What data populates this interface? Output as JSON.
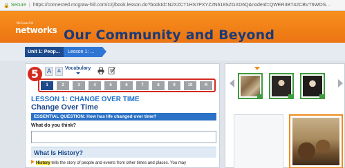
{
  "browser": {
    "secure_label": "Secure",
    "url": "https://connected.mcgraw-hill.com/c2j/book.lesson.do?bookId=N2XZCT1HS7PXYZ2N618SZGXD6Q&nodeId=QWER3BT42CBVT6WOS..."
  },
  "banner": {
    "publisher": "McGraw-Hill",
    "logo_text": "networks",
    "title": "Our Community and Beyond"
  },
  "breadcrumb": {
    "unit": "Unit 1: Peop...",
    "lesson": "Lesson 1: ..."
  },
  "toolbar": {
    "font_large": "A",
    "font_small": "A",
    "vocabulary": "Vocabulary",
    "callout_number": "5"
  },
  "pager": {
    "pages": [
      "1",
      "2",
      "3",
      "4",
      "5",
      "6",
      "7",
      "8",
      "9",
      "10",
      "R"
    ],
    "active_index": 0
  },
  "lesson": {
    "heading": "LESSON 1: CHANGE OVER TIME",
    "subheading": "Change Over Time",
    "essential_question": "ESSENTIAL QUESTION: How has life changed over time?",
    "prompt_label": "What do you think?",
    "section_title": "What Is History?",
    "body_keyword": "History",
    "body_text": " tells the story of people and events from other times and places. You may"
  },
  "media": {
    "thumbnails": [
      "historical-scene",
      "portrait-1",
      "portrait-2"
    ]
  },
  "colors": {
    "banner_orange": "#ec7413",
    "title_blue": "#1a3a78",
    "callout_red": "#d42a1f",
    "active_page": "#1d4a8c",
    "thumb_border": "#3e9b3e"
  }
}
